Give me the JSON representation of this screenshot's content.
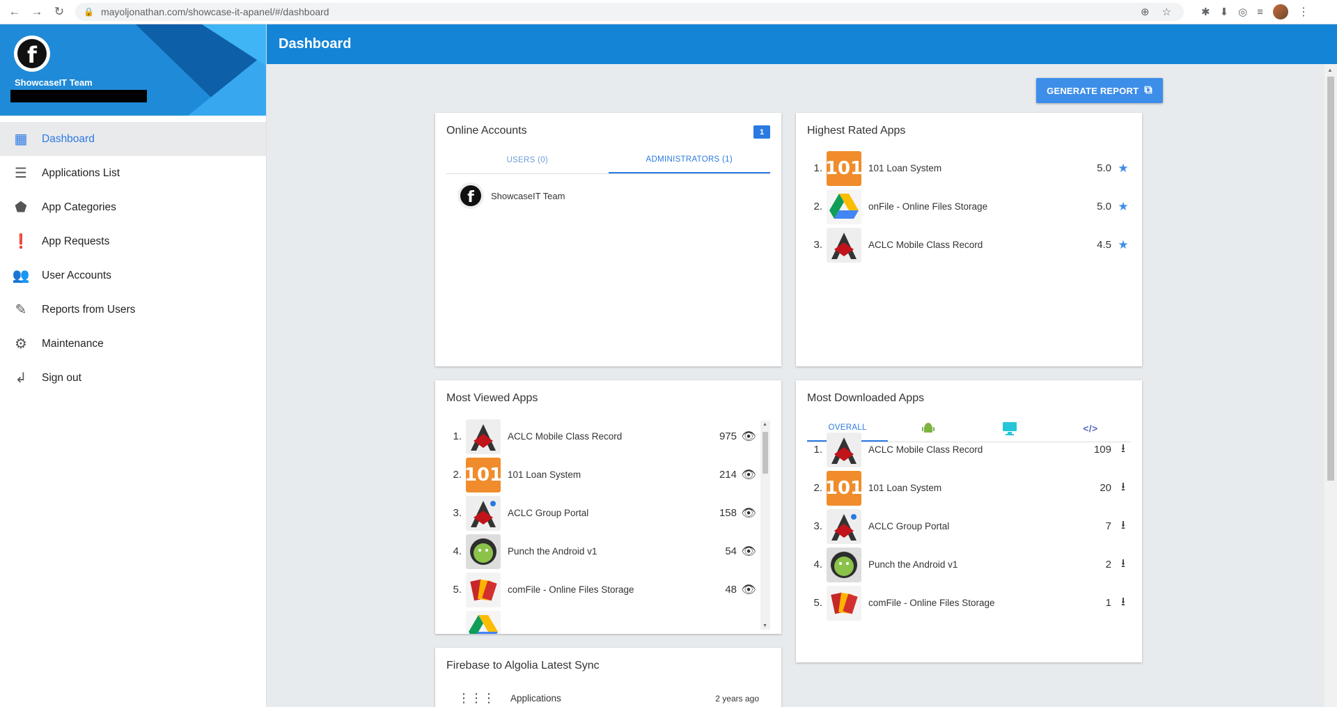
{
  "browser": {
    "url": "mayoljonathan.com/showcase-it-apanel/#/dashboard"
  },
  "sidebar": {
    "team_name": "ShowcaseIT Team",
    "items": [
      {
        "label": "Dashboard",
        "icon": "dashboard-icon",
        "active": true
      },
      {
        "label": "Applications List",
        "icon": "list-icon",
        "active": false
      },
      {
        "label": "App Categories",
        "icon": "label-icon",
        "active": false
      },
      {
        "label": "App Requests",
        "icon": "alert-icon",
        "active": false
      },
      {
        "label": "User Accounts",
        "icon": "people-icon",
        "active": false
      },
      {
        "label": "Reports from Users",
        "icon": "report-icon",
        "active": false
      },
      {
        "label": "Maintenance",
        "icon": "gear-icon",
        "active": false
      },
      {
        "label": "Sign out",
        "icon": "sign-out-icon",
        "active": false
      }
    ]
  },
  "header": {
    "title": "Dashboard"
  },
  "generate_report": {
    "label": "GENERATE REPORT"
  },
  "online_accounts": {
    "title": "Online Accounts",
    "count": "1",
    "tabs": [
      "USERS (0)",
      "ADMINISTRATORS (1)"
    ],
    "users": [
      "ShowcaseIT Team"
    ]
  },
  "highest_rated": {
    "title": "Highest Rated Apps",
    "rows": [
      {
        "rank": "1.",
        "name": "101 Loan System",
        "value": "5.0",
        "icon": "101"
      },
      {
        "rank": "2.",
        "name": "onFile - Online Files Storage",
        "value": "5.0",
        "icon": "drive"
      },
      {
        "rank": "3.",
        "name": "ACLC Mobile Class Record",
        "value": "4.5",
        "icon": "aclc"
      }
    ]
  },
  "most_viewed": {
    "title": "Most Viewed Apps",
    "rows": [
      {
        "rank": "1.",
        "name": "ACLC Mobile Class Record",
        "value": "975",
        "icon": "aclc"
      },
      {
        "rank": "2.",
        "name": "101 Loan System",
        "value": "214",
        "icon": "101"
      },
      {
        "rank": "3.",
        "name": "ACLC Group Portal",
        "value": "158",
        "icon": "aclc"
      },
      {
        "rank": "4.",
        "name": "Punch the Android v1",
        "value": "54",
        "icon": "android"
      },
      {
        "rank": "5.",
        "name": "comFile - Online Files Storage",
        "value": "48",
        "icon": "comfile"
      }
    ]
  },
  "most_downloaded": {
    "title": "Most Downloaded Apps",
    "tabs": [
      "OVERALL"
    ],
    "rows": [
      {
        "rank": "1.",
        "name": "ACLC Mobile Class Record",
        "value": "109",
        "icon": "aclc"
      },
      {
        "rank": "2.",
        "name": "101 Loan System",
        "value": "20",
        "icon": "101"
      },
      {
        "rank": "3.",
        "name": "ACLC Group Portal",
        "value": "7",
        "icon": "aclc"
      },
      {
        "rank": "4.",
        "name": "Punch the Android v1",
        "value": "2",
        "icon": "android"
      },
      {
        "rank": "5.",
        "name": "comFile - Online Files Storage",
        "value": "1",
        "icon": "comfile"
      }
    ]
  },
  "sync": {
    "title": "Firebase to Algolia Latest Sync",
    "row_label": "Applications",
    "row_time": "2 years ago"
  },
  "colors": {
    "primary": "#1484d6",
    "accent": "#2a7ae2",
    "background": "#e8ebee"
  }
}
